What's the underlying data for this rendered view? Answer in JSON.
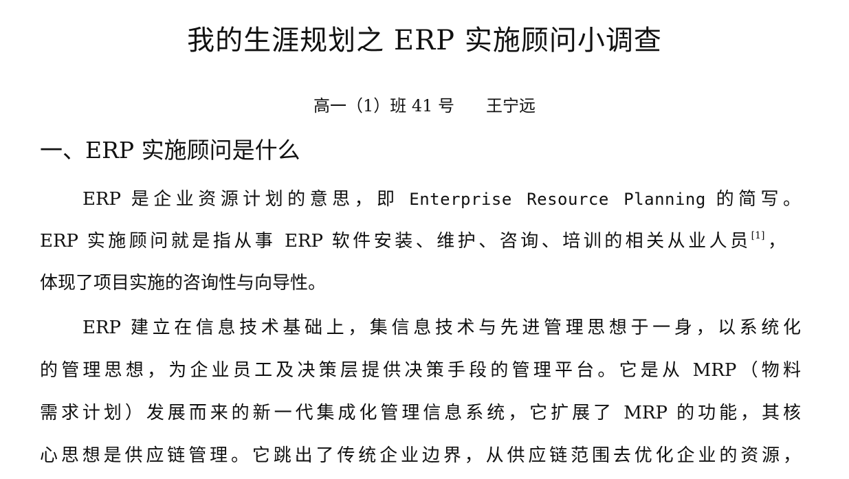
{
  "document": {
    "title": "我的生涯规划之 ERP 实施顾问小调查",
    "byline": {
      "class_info": "高一（1）班 41 号",
      "author": "王宁远"
    },
    "section1": {
      "heading": "一、ERP 实施顾问是什么",
      "para1": {
        "line1_a": "ERP 是企业资源计划的意思，即 ",
        "line1_english": "Enterprise Resource Planning",
        "line1_b": " 的简写。",
        "line2_a": "ERP 实施顾问就是指从事 ERP 软件安装、维护、咨询、培训的相关从业人员",
        "line2_cite": "[1]",
        "line2_b": "，",
        "line3": "体现了项目实施的咨询性与向导性。"
      },
      "para2": {
        "line1": "ERP 建立在信息技术基础上，集信息技术与先进管理思想于一身，以系统化",
        "line2": "的管理思想，为企业员工及决策层提供决策手段的管理平台。它是从 MRP（物料",
        "line3": "需求计划）发展而来的新一代集成化管理信息系统，它扩展了 MRP 的功能，其核",
        "line4": "心思想是供应链管理。它跳出了传统企业边界，从供应链范围去优化企业的资源，"
      }
    }
  }
}
